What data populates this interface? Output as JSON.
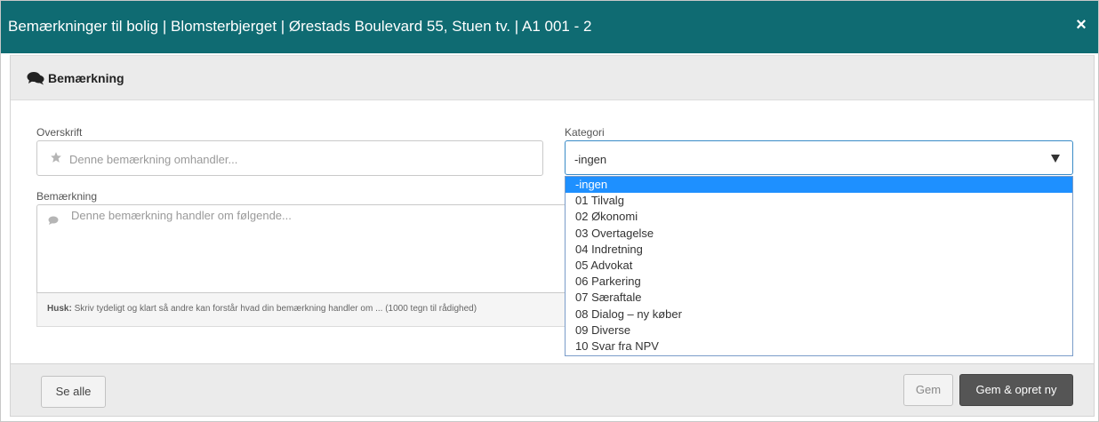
{
  "modal": {
    "title": "Bemærkninger til bolig | Blomsterbjerget | Ørestads Boulevard 55, Stuen tv. | A1 001 - 2",
    "close_icon": "close-icon"
  },
  "panel": {
    "heading": "Bemærkning",
    "heading_icon": "comments-icon"
  },
  "form": {
    "overskrift_label": "Overskrift",
    "overskrift_placeholder": "Denne bemærkning omhandler...",
    "bemaerkning_label": "Bemærkning",
    "bemaerkning_placeholder": "Denne bemærkning handler om følgende...",
    "help_bold": "Husk:",
    "help_text": " Skriv tydeligt og klart så andre kan forstår hvad din bemærkning handler om ... (1000 tegn til rådighed)",
    "kategori_label": "Kategori",
    "kategori_value": "-ingen",
    "kategori_options": [
      "-ingen",
      "01 Tilvalg",
      "02 Økonomi",
      "03 Overtagelse",
      "04 Indretning",
      "05 Advokat",
      "06 Parkering",
      "07 Særaftale",
      "08 Dialog – ny køber",
      "09 Diverse",
      "10 Svar fra NPV"
    ],
    "selected_index": 0
  },
  "footer": {
    "see_all_label": "Se alle",
    "save_label": "Gem",
    "save_new_label": "Gem & opret ny"
  },
  "colors": {
    "title_bar": "#0f6b72",
    "selected_option": "#1e90ff",
    "primary_button": "#555555"
  }
}
